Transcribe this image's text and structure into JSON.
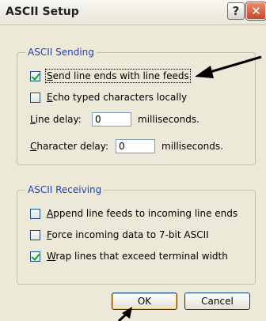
{
  "window": {
    "title": "ASCII Setup",
    "help_icon": "?",
    "close_icon": "✕"
  },
  "sending": {
    "legend": "ASCII Sending",
    "send_line_ends": {
      "label": "Send line ends with line feeds",
      "checked": true
    },
    "echo_chars": {
      "label": "Echo typed characters locally",
      "checked": false
    },
    "line_delay": {
      "label": "Line delay:",
      "value": "0",
      "unit": "milliseconds."
    },
    "char_delay": {
      "label": "Character delay:",
      "value": "0",
      "unit": "milliseconds."
    }
  },
  "receiving": {
    "legend": "ASCII Receiving",
    "append_lf": {
      "label": "Append line feeds to incoming line ends",
      "checked": false
    },
    "force_7bit": {
      "label": "Force incoming data to 7-bit ASCII",
      "checked": false
    },
    "wrap_lines": {
      "label": "Wrap lines that exceed terminal width",
      "checked": true
    }
  },
  "buttons": {
    "ok": "OK",
    "cancel": "Cancel"
  },
  "colors": {
    "legend": "#1f3fbf",
    "dialog_bg": "#ece9d8",
    "annotation_arrow": "#000000"
  }
}
